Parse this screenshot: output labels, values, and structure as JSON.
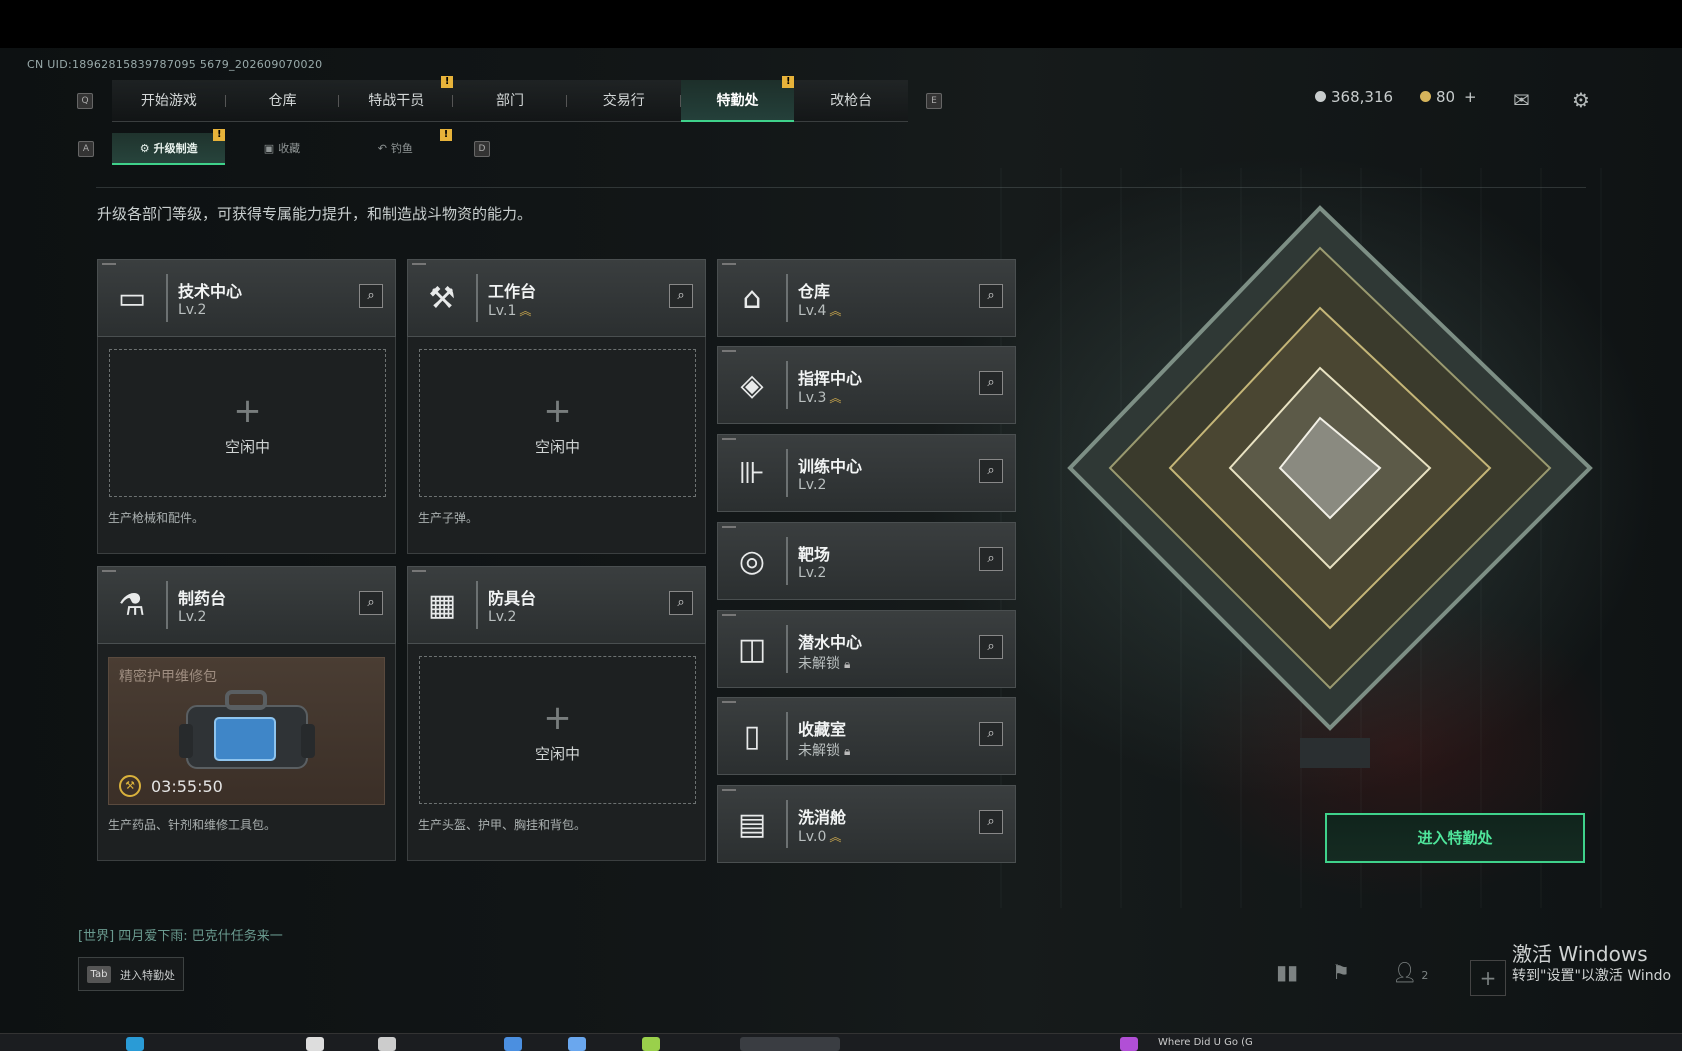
{
  "uid": "CN UID:18962815839787095 5679_202609070020",
  "nav": {
    "key_left": "Q",
    "key_right": "E",
    "tabs": [
      {
        "label": "开始游戏",
        "badge": ""
      },
      {
        "label": "仓库",
        "badge": ""
      },
      {
        "label": "特战干员",
        "badge": "!"
      },
      {
        "label": "部门",
        "badge": ""
      },
      {
        "label": "交易行",
        "badge": ""
      },
      {
        "label": "特勤处",
        "badge": "!"
      },
      {
        "label": "改枪台",
        "badge": ""
      }
    ],
    "active_index": 5
  },
  "subnav": {
    "key_left": "A",
    "key_right": "D",
    "tabs": [
      {
        "label": "升级制造",
        "badge": "!"
      },
      {
        "label": "收藏",
        "badge": ""
      },
      {
        "label": "钓鱼",
        "badge": "!"
      }
    ]
  },
  "currency": {
    "silver": "368,316",
    "gold": "80",
    "add": "+"
  },
  "description": "升级各部门等级，可获得专属能力提升，和制造战斗物资的能力。",
  "left_cards": [
    {
      "name": "技术中心",
      "level": "Lv.2",
      "upgradable": false,
      "status": "空闲中",
      "footer": "生产枪械和配件。",
      "icon": "tech-center-icon"
    },
    {
      "name": "工作台",
      "level": "Lv.1",
      "upgradable": true,
      "status": "空闲中",
      "footer": "生产子弹。",
      "icon": "workbench-icon"
    },
    {
      "name": "制药台",
      "level": "Lv.2",
      "upgradable": false,
      "status": "",
      "footer": "生产药品、针剂和维修工具包。",
      "icon": "pharmacy-icon"
    },
    {
      "name": "防具台",
      "level": "Lv.2",
      "upgradable": false,
      "status": "空闲中",
      "footer": "生产头盔、护甲、胸挂和背包。",
      "icon": "armor-bench-icon"
    }
  ],
  "crafting": {
    "item_name": "精密护甲维修包",
    "timer": "03:55:50"
  },
  "right_cards": [
    {
      "name": "仓库",
      "level": "Lv.4",
      "upgradable": true,
      "locked": false,
      "icon": "warehouse-icon"
    },
    {
      "name": "指挥中心",
      "level": "Lv.3",
      "upgradable": true,
      "locked": false,
      "icon": "command-center-icon"
    },
    {
      "name": "训练中心",
      "level": "Lv.2",
      "upgradable": false,
      "locked": false,
      "icon": "training-center-icon"
    },
    {
      "name": "靶场",
      "level": "Lv.2",
      "upgradable": false,
      "locked": false,
      "icon": "shooting-range-icon"
    },
    {
      "name": "潜水中心",
      "level": "未解锁",
      "upgradable": false,
      "locked": true,
      "icon": "diving-center-icon"
    },
    {
      "name": "收藏室",
      "level": "未解锁",
      "upgradable": false,
      "locked": true,
      "icon": "collection-room-icon"
    },
    {
      "name": "洗消舱",
      "level": "Lv.0",
      "upgradable": true,
      "locked": false,
      "icon": "decon-chamber-icon"
    }
  ],
  "enter_button": "进入特勤处",
  "chat": "[世界] 四月爱下雨: 巴克什任务来一",
  "tab_hint": {
    "key": "Tab",
    "label": "进入特勤处"
  },
  "party_count": "2",
  "watermark": {
    "line1": "激活 Windows",
    "line2": "转到\"设置\"以激活 Windo"
  },
  "taskbar_text": "Where Did U Go (G",
  "colors": {
    "accent": "#3fd28b",
    "badge": "#e7b33a",
    "upgrade_arrow": "#c8a64e"
  }
}
